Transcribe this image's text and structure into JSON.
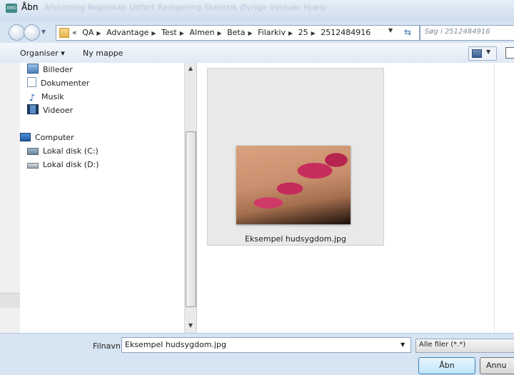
{
  "window": {
    "app_icon_text": "XMO",
    "title": "Åbn",
    "background_menu": "Afslutning   Regnskab   Udført   Redigering   Statistik   Øvrige   Vinduer   Hjælp"
  },
  "address": {
    "crumbs": [
      "«",
      "QA",
      "Advantage",
      "Test",
      "Almen",
      "Beta",
      "Filarkiv",
      "25",
      "2512484916"
    ],
    "search_placeholder": "Søg i 2512484916"
  },
  "toolbar": {
    "organize_label": "Organiser ▾",
    "new_folder_label": "Ny mappe"
  },
  "nav": {
    "items": [
      {
        "label": "Billeder",
        "icon": "pictures-icon"
      },
      {
        "label": "Dokumenter",
        "icon": "documents-icon"
      },
      {
        "label": "Musik",
        "icon": "music-icon"
      },
      {
        "label": "Videoer",
        "icon": "videos-icon"
      },
      {
        "label": "Computer",
        "icon": "computer-icon"
      },
      {
        "label": "Lokal disk (C:)",
        "icon": "system-drive-icon"
      },
      {
        "label": "Lokal disk (D:)",
        "icon": "drive-icon"
      }
    ]
  },
  "files": [
    {
      "name": "Eksempel hudsygdom.jpg"
    }
  ],
  "bottom": {
    "filename_label": "Filnavn:",
    "filename_value": "Eksempel hudsygdom.jpg",
    "filetype_value": "Alle filer (*.*)",
    "open_label": "Åbn",
    "cancel_label": "Annu"
  }
}
